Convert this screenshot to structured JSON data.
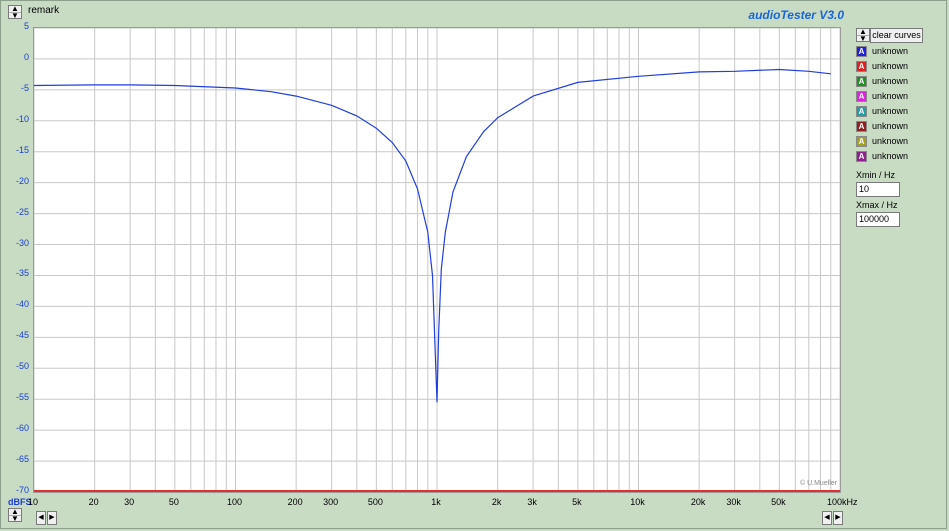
{
  "header": {
    "remark_label": "remark",
    "app_title": "audioTester  V3.0"
  },
  "right_panel": {
    "clear_label": "clear curves",
    "legend": [
      {
        "letter": "A",
        "label": "unknown",
        "color": "#2020e0"
      },
      {
        "letter": "A",
        "label": "unknown",
        "color": "#e02020"
      },
      {
        "letter": "A",
        "label": "unknown",
        "color": "#209020"
      },
      {
        "letter": "A",
        "label": "unknown",
        "color": "#e020e0"
      },
      {
        "letter": "A",
        "label": "unknown",
        "color": "#20a0a0"
      },
      {
        "letter": "A",
        "label": "unknown",
        "color": "#902020"
      },
      {
        "letter": "A",
        "label": "unknown",
        "color": "#a0a020"
      },
      {
        "letter": "A",
        "label": "unknown",
        "color": "#902090"
      }
    ],
    "xmin_label": "min / Hz",
    "xmin_value": "10",
    "xmax_label": "max / Hz",
    "xmax_value": "100000"
  },
  "footer": {
    "y_unit": "dBFS",
    "copyright": "© U.Mueller"
  },
  "colors": {
    "curve": "#1f3fe0",
    "tick_blue": "#1a3fd0",
    "baseline": "#e03030",
    "grid": "#c8c8c8",
    "background": "#c8dcc4"
  },
  "chart_data": {
    "type": "line",
    "x_scale": "log",
    "xlim": [
      10,
      100000
    ],
    "ylim": [
      -70,
      5
    ],
    "x_tick_values": [
      10,
      20,
      30,
      50,
      100,
      200,
      300,
      500,
      1000,
      2000,
      3000,
      5000,
      10000,
      20000,
      30000,
      50000,
      100000
    ],
    "x_tick_labels": [
      "10",
      "20",
      "30",
      "50",
      "100",
      "200",
      "300",
      "500",
      "1k",
      "2k",
      "3k",
      "5k",
      "10k",
      "20k",
      "30k",
      "50k",
      "100kHz"
    ],
    "y_ticks": [
      5,
      0,
      -5,
      -10,
      -15,
      -20,
      -25,
      -30,
      -35,
      -40,
      -45,
      -50,
      -55,
      -60,
      -65,
      -70
    ],
    "grid": true,
    "series": [
      {
        "color": "#1f3fe0",
        "x": [
          10,
          20,
          30,
          50,
          100,
          150,
          200,
          300,
          400,
          500,
          600,
          700,
          800,
          900,
          950,
          1000,
          1020,
          1050,
          1100,
          1200,
          1400,
          1700,
          2000,
          3000,
          5000,
          10000,
          20000,
          30000,
          50000,
          70000,
          90000
        ],
        "y": [
          -4.3,
          -4.2,
          -4.2,
          -4.3,
          -4.7,
          -5.3,
          -6.0,
          -7.5,
          -9.2,
          -11.2,
          -13.5,
          -16.5,
          -21.0,
          -28.0,
          -35.0,
          -55.5,
          -44.0,
          -34.0,
          -28.0,
          -21.5,
          -15.8,
          -11.8,
          -9.5,
          -6.0,
          -3.8,
          -2.8,
          -2.1,
          -2.0,
          -1.7,
          -2.0,
          -2.4
        ]
      }
    ]
  }
}
